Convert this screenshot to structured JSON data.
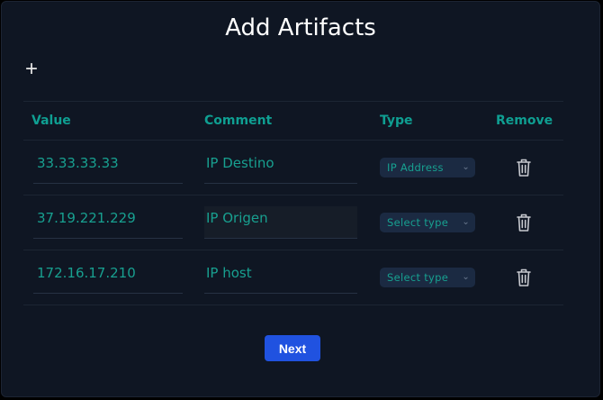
{
  "dialog": {
    "title": "Add Artifacts",
    "add_icon": "plus-icon",
    "add_glyph": "+"
  },
  "table": {
    "headers": {
      "value": "Value",
      "comment": "Comment",
      "type": "Type",
      "remove": "Remove"
    },
    "rows": [
      {
        "value": "33.33.33.33",
        "comment": "IP Destino",
        "type": "IP Address"
      },
      {
        "value": "37.19.221.229",
        "comment": "IP Origen",
        "type": "Select type"
      },
      {
        "value": "172.16.17.210",
        "comment": "IP host",
        "type": "Select type"
      }
    ],
    "remove_icon": "trash-icon"
  },
  "footer": {
    "next_label": "Next"
  },
  "colors": {
    "background": "#0f1623",
    "accent_text": "#18a090",
    "header_text": "#0f9f92",
    "select_bg": "#1b2a42",
    "primary_button": "#2052e0"
  }
}
